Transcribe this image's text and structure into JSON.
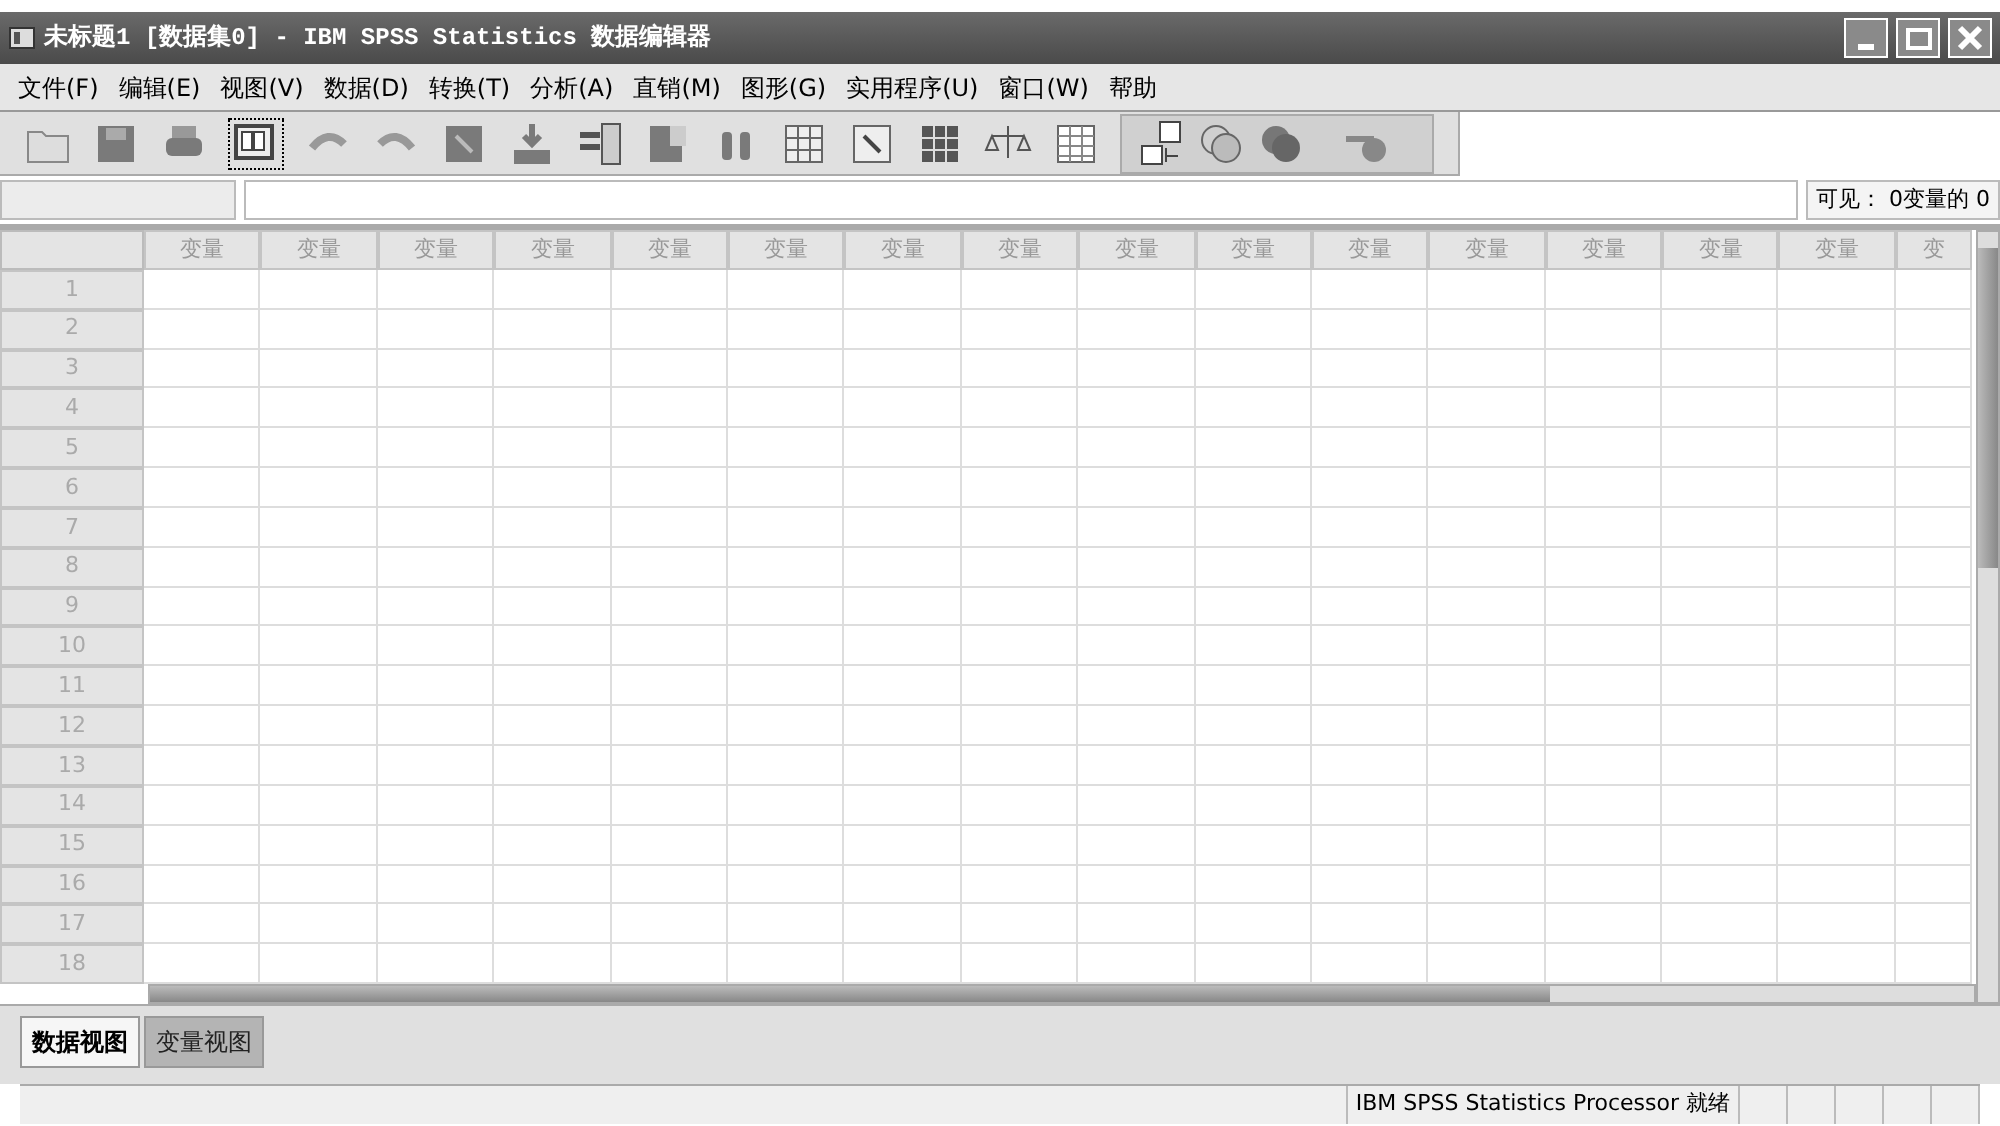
{
  "window": {
    "title": "未标题1 [数据集0] - IBM SPSS Statistics 数据编辑器"
  },
  "menu": [
    "文件(F)",
    "编辑(E)",
    "视图(V)",
    "数据(D)",
    "转换(T)",
    "分析(A)",
    "直销(M)",
    "图形(G)",
    "实用程序(U)",
    "窗口(W)",
    "帮助"
  ],
  "cell_editor": {
    "visible_count": "可见： 0变量的 0"
  },
  "table": {
    "columns": [
      "变量",
      "变量",
      "变量",
      "变量",
      "变量",
      "变量",
      "变量",
      "变量",
      "变量",
      "变量",
      "变量",
      "变量",
      "变量",
      "变量",
      "变量",
      "变"
    ],
    "rows": [
      "1",
      "2",
      "3",
      "4",
      "5",
      "6",
      "7",
      "8",
      "9",
      "10",
      "11",
      "12",
      "13",
      "14",
      "15",
      "16",
      "17",
      "18"
    ]
  },
  "tabs": [
    {
      "label": "数据视图",
      "selected": true
    },
    {
      "label": "变量视图",
      "selected": false
    }
  ],
  "status_bar": {
    "text": "IBM SPSS Statistics Processor 就绪"
  }
}
